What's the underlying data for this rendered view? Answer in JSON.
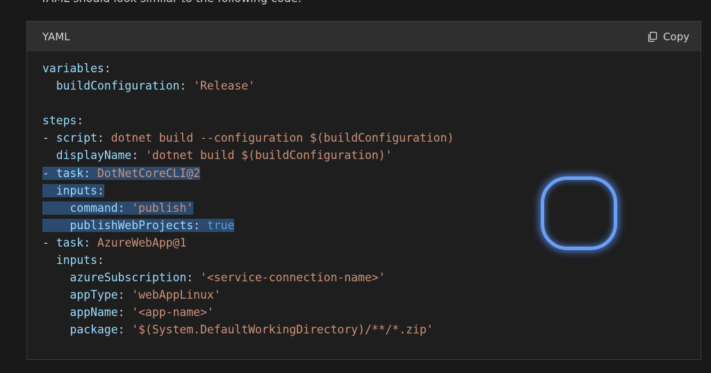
{
  "page": {
    "intro_text": "YAML should look similar to the following code:"
  },
  "code_block": {
    "language": "YAML",
    "copy_label": "Copy",
    "lines": [
      {
        "indent": "",
        "dash": "",
        "key": "variables",
        "sep": ":",
        "value": "",
        "value_kind": "none"
      },
      {
        "indent": "  ",
        "dash": "",
        "key": "buildConfiguration",
        "sep": ": ",
        "value": "'Release'",
        "value_kind": "string"
      },
      {
        "indent": "",
        "dash": "",
        "key": "",
        "sep": "",
        "value": "",
        "value_kind": "none"
      },
      {
        "indent": "",
        "dash": "",
        "key": "steps",
        "sep": ":",
        "value": "",
        "value_kind": "none"
      },
      {
        "indent": "",
        "dash": "- ",
        "key": "script",
        "sep": ": ",
        "value": "dotnet build --configuration $(buildConfiguration)",
        "value_kind": "string"
      },
      {
        "indent": "  ",
        "dash": "",
        "key": "displayName",
        "sep": ": ",
        "value": "'dotnet build $(buildConfiguration)'",
        "value_kind": "string"
      },
      {
        "indent": "",
        "dash": "- ",
        "key": "task",
        "sep": ": ",
        "value": "DotNetCoreCLI@2",
        "value_kind": "string",
        "selected": true
      },
      {
        "indent": "  ",
        "dash": "",
        "key": "inputs",
        "sep": ":",
        "value": "",
        "value_kind": "none",
        "selected": true
      },
      {
        "indent": "    ",
        "dash": "",
        "key": "command",
        "sep": ": ",
        "value": "'publish'",
        "value_kind": "string",
        "selected": true
      },
      {
        "indent": "    ",
        "dash": "",
        "key": "publishWebProjects",
        "sep": ": ",
        "value": "true",
        "value_kind": "bool",
        "selected": true
      },
      {
        "indent": "",
        "dash": "- ",
        "key": "task",
        "sep": ": ",
        "value": "AzureWebApp@1",
        "value_kind": "string"
      },
      {
        "indent": "  ",
        "dash": "",
        "key": "inputs",
        "sep": ":",
        "value": "",
        "value_kind": "none"
      },
      {
        "indent": "    ",
        "dash": "",
        "key": "azureSubscription",
        "sep": ": ",
        "value": "'<service-connection-name>'",
        "value_kind": "string"
      },
      {
        "indent": "    ",
        "dash": "",
        "key": "appType",
        "sep": ": ",
        "value": "'webAppLinux'",
        "value_kind": "string"
      },
      {
        "indent": "    ",
        "dash": "",
        "key": "appName",
        "sep": ": ",
        "value": "'<app-name>'",
        "value_kind": "string"
      },
      {
        "indent": "    ",
        "dash": "",
        "key": "package",
        "sep": ": ",
        "value": "'$(System.DefaultWorkingDirectory)/**/*.zip'",
        "value_kind": "string"
      }
    ]
  },
  "colors": {
    "background": "#191919",
    "code_background": "#1e1e1e",
    "header_background": "#2f2f2f",
    "key": "#9cdcfe",
    "string": "#ce9178",
    "boolean": "#569cd6",
    "selection": "#2c4a6e",
    "focus_ring": "#6fa8ff"
  },
  "icons": {
    "copy": "copy-icon"
  }
}
